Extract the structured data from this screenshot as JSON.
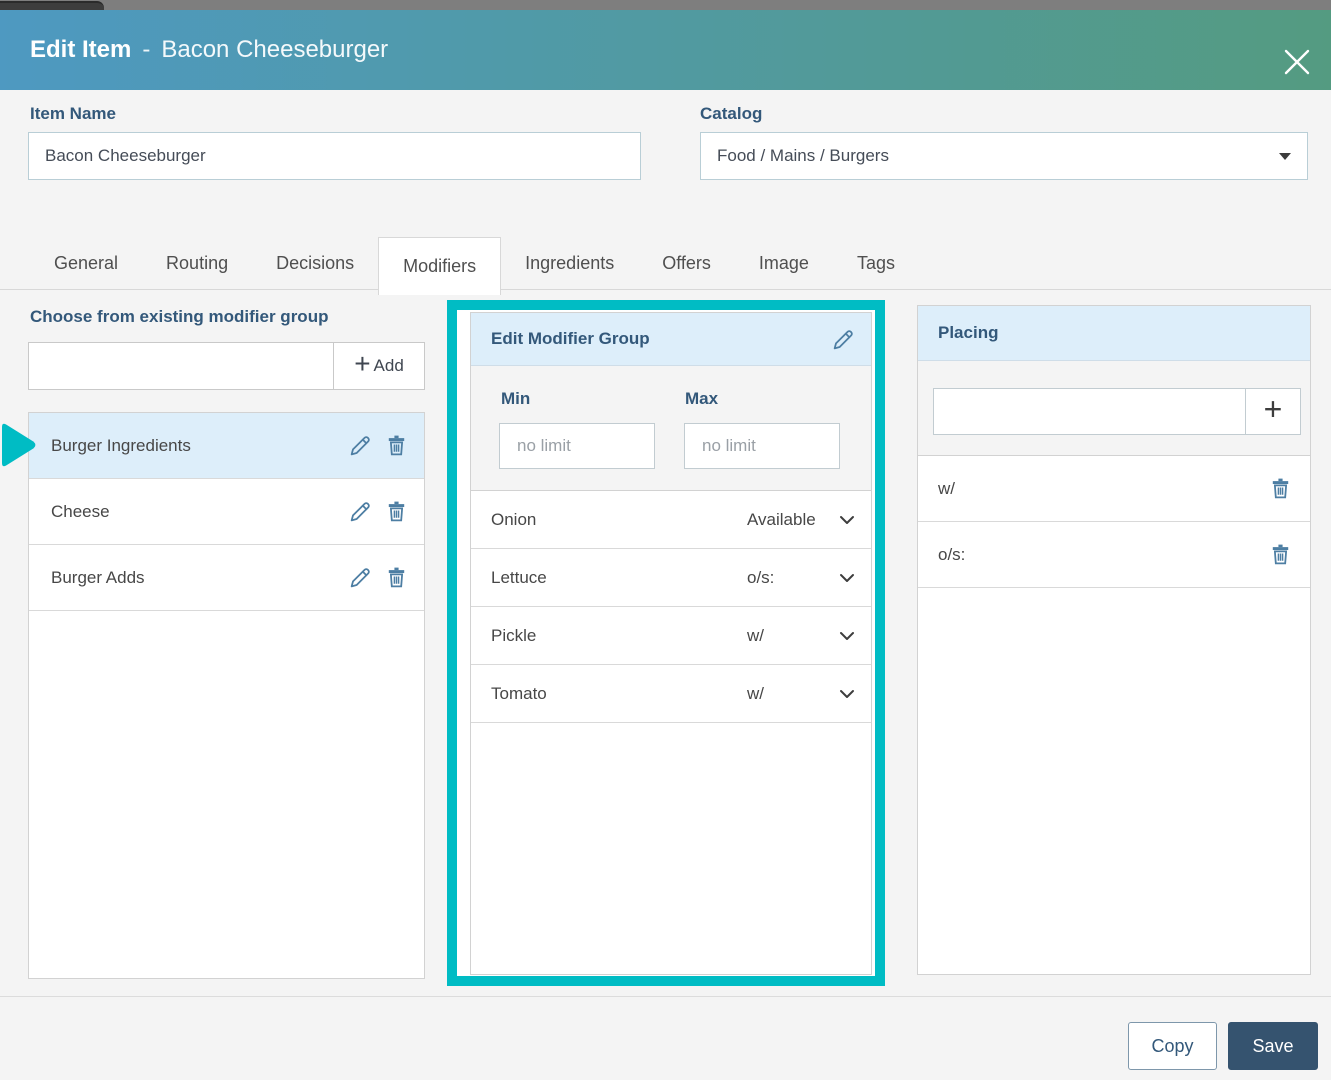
{
  "header": {
    "title": "Edit Item",
    "separator": "-",
    "item": "Bacon Cheeseburger"
  },
  "form": {
    "item_name": {
      "label": "Item Name",
      "value": "Bacon Cheeseburger"
    },
    "catalog": {
      "label": "Catalog",
      "value": "Food / Mains / Burgers"
    }
  },
  "tabs": [
    {
      "label": "General",
      "active": false
    },
    {
      "label": "Routing",
      "active": false
    },
    {
      "label": "Decisions",
      "active": false
    },
    {
      "label": "Modifiers",
      "active": true
    },
    {
      "label": "Ingredients",
      "active": false
    },
    {
      "label": "Offers",
      "active": false
    },
    {
      "label": "Image",
      "active": false
    },
    {
      "label": "Tags",
      "active": false
    }
  ],
  "existing_groups": {
    "title": "Choose from existing modifier group",
    "search_value": "",
    "add_label": "Add",
    "groups": [
      {
        "name": "Burger Ingredients",
        "selected": true
      },
      {
        "name": "Cheese",
        "selected": false
      },
      {
        "name": "Burger Adds",
        "selected": false
      }
    ]
  },
  "modifier_group": {
    "title": "Edit Modifier Group",
    "highlighted": true,
    "min_label": "Min",
    "max_label": "Max",
    "min_placeholder": "no limit",
    "max_placeholder": "no limit",
    "min_value": "",
    "max_value": "",
    "modifiers": [
      {
        "name": "Onion",
        "state": "Available"
      },
      {
        "name": "Lettuce",
        "state": "o/s:"
      },
      {
        "name": "Pickle",
        "state": "w/"
      },
      {
        "name": "Tomato",
        "state": "w/"
      }
    ]
  },
  "placing": {
    "title": "Placing",
    "input_value": "",
    "items": [
      {
        "name": "w/"
      },
      {
        "name": "o/s:"
      }
    ]
  },
  "footer": {
    "copy_label": "Copy",
    "save_label": "Save"
  },
  "icons": {
    "plus": "+"
  },
  "colors": {
    "header_gradient_start": "#4e99c1",
    "header_gradient_end": "#549b81",
    "accent_teal": "#00bcc4",
    "selected_row_bg": "#ddeefa",
    "panel_header_bg": "#ddeefa",
    "label_blue": "#33587a",
    "icon_blue": "#4d7ea3",
    "save_button_bg": "#35536f",
    "body_bg": "#f4f4f4"
  }
}
